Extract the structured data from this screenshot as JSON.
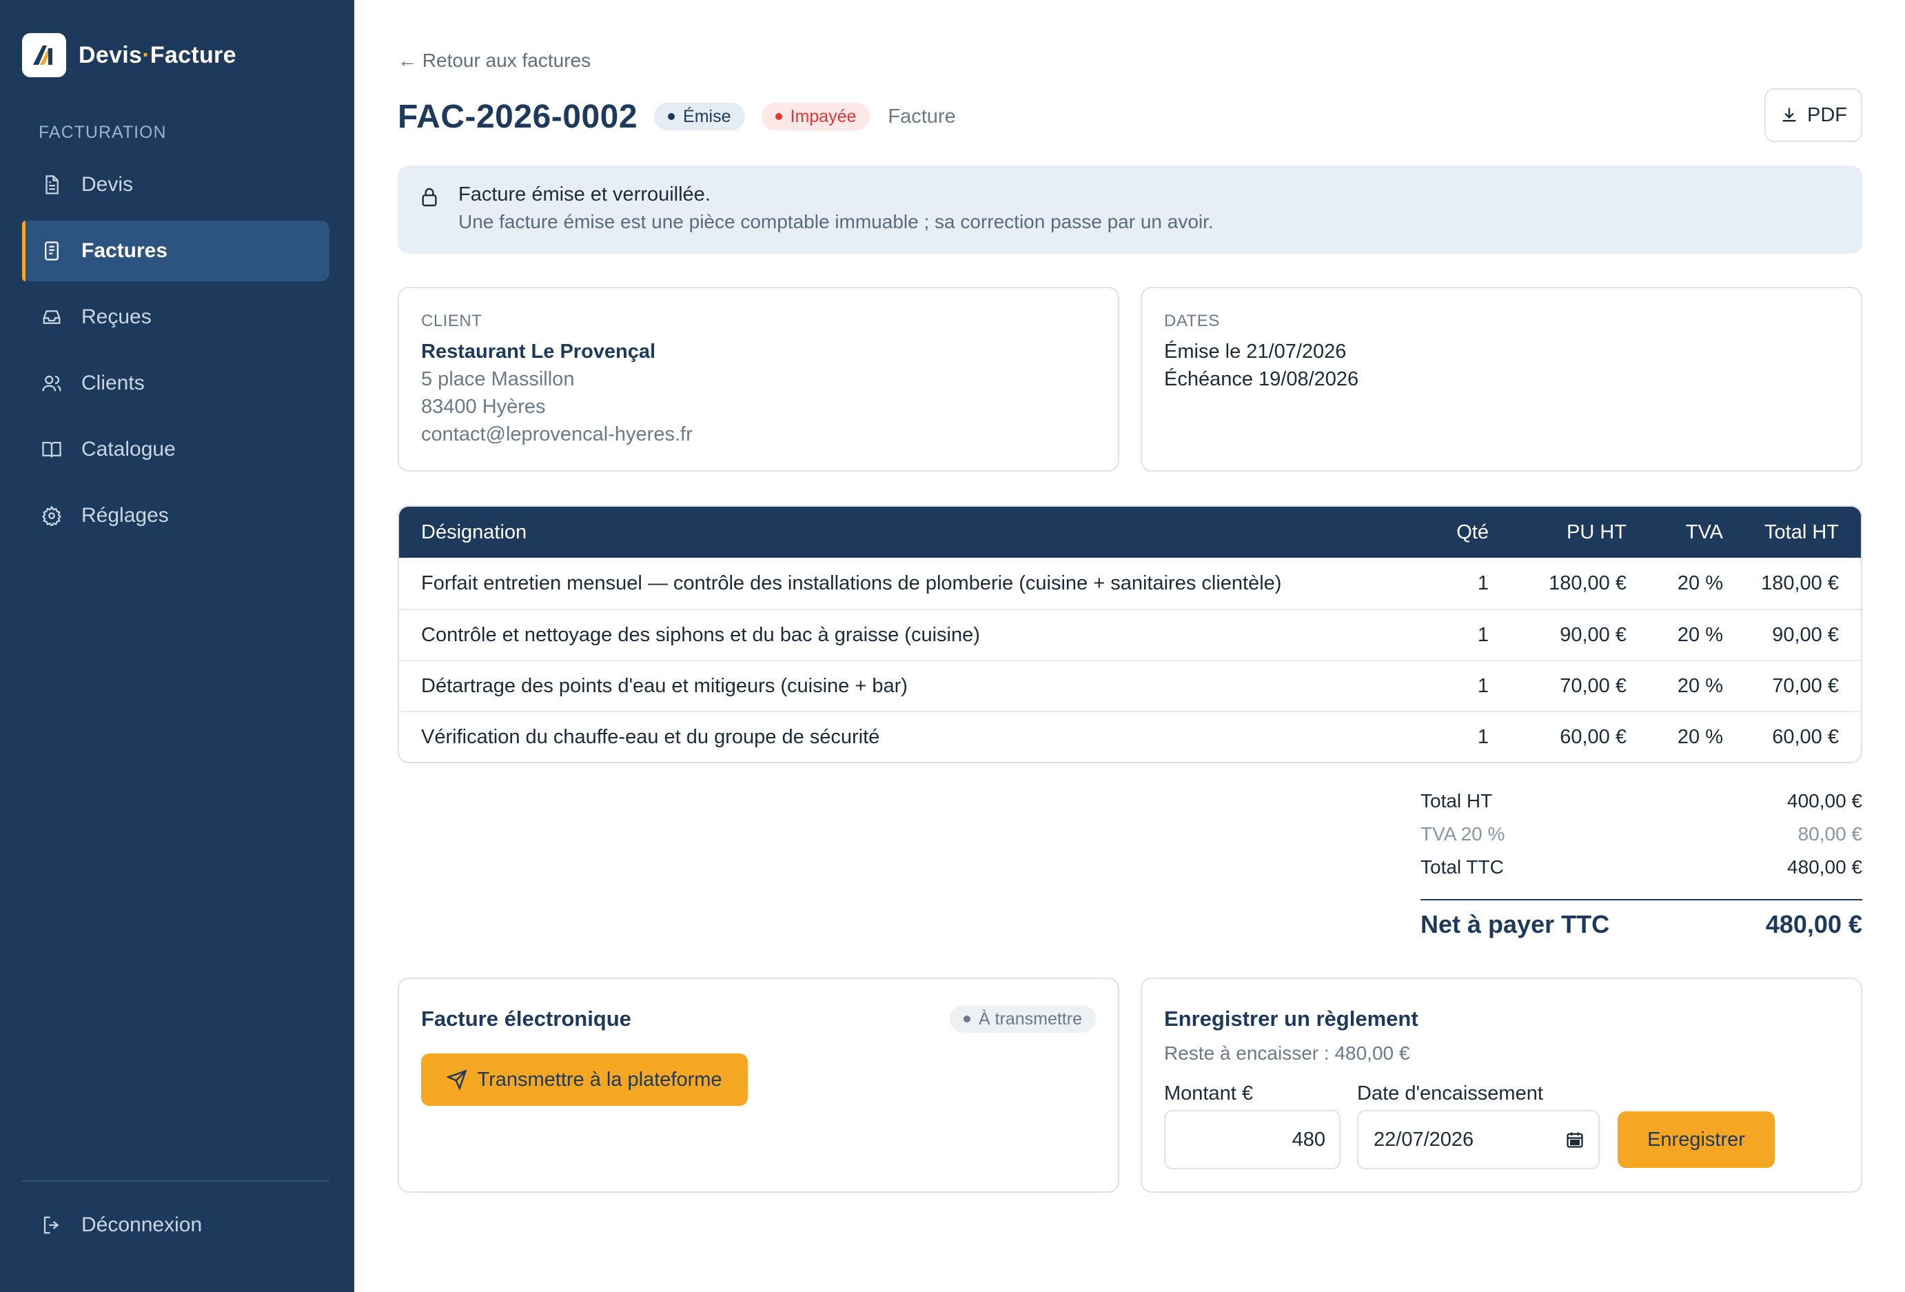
{
  "brand": {
    "name_part1": "Devis",
    "separator": "·",
    "name_part2": "Facture"
  },
  "sidebar": {
    "section_label": "FACTURATION",
    "items": [
      {
        "label": "Devis",
        "icon": "document-icon"
      },
      {
        "label": "Factures",
        "icon": "invoice-icon",
        "active": true
      },
      {
        "label": "Reçues",
        "icon": "inbox-icon"
      },
      {
        "label": "Clients",
        "icon": "users-icon"
      },
      {
        "label": "Catalogue",
        "icon": "book-icon"
      },
      {
        "label": "Réglages",
        "icon": "gear-icon"
      }
    ],
    "logout_label": "Déconnexion"
  },
  "header": {
    "back_link": "← Retour aux factures",
    "title": "FAC-2026-0002",
    "status_badge": "Émise",
    "payment_badge": "Impayée",
    "doc_type": "Facture",
    "pdf_label": "PDF"
  },
  "notice": {
    "title": "Facture émise et verrouillée.",
    "text": "Une facture émise est une pièce comptable immuable ; sa correction passe par un avoir."
  },
  "client": {
    "label": "CLIENT",
    "name": "Restaurant Le Provençal",
    "address": "5 place Massillon",
    "city": "83400 Hyères",
    "email": "contact@leprovencal-hyeres.fr"
  },
  "dates": {
    "label": "DATES",
    "issued": "Émise le 21/07/2026",
    "due": "Échéance 19/08/2026"
  },
  "table": {
    "headers": {
      "designation": "Désignation",
      "qty": "Qté",
      "unit_price": "PU HT",
      "vat": "TVA",
      "total": "Total HT"
    },
    "rows": [
      {
        "designation": "Forfait entretien mensuel — contrôle des installations de plomberie (cuisine + sanitaires clientèle)",
        "qty": "1",
        "unit_price": "180,00 €",
        "vat": "20 %",
        "total": "180,00 €"
      },
      {
        "designation": "Contrôle et nettoyage des siphons et du bac à graisse (cuisine)",
        "qty": "1",
        "unit_price": "90,00 €",
        "vat": "20 %",
        "total": "90,00 €"
      },
      {
        "designation": "Détartrage des points d'eau et mitigeurs (cuisine + bar)",
        "qty": "1",
        "unit_price": "70,00 €",
        "vat": "20 %",
        "total": "70,00 €"
      },
      {
        "designation": "Vérification du chauffe-eau et du groupe de sécurité",
        "qty": "1",
        "unit_price": "60,00 €",
        "vat": "20 %",
        "total": "60,00 €"
      }
    ]
  },
  "totals": {
    "ht_label": "Total HT",
    "ht_value": "400,00 €",
    "vat_label": "TVA 20 %",
    "vat_value": "80,00 €",
    "ttc_label": "Total TTC",
    "ttc_value": "480,00 €",
    "net_label": "Net à payer TTC",
    "net_value": "480,00 €"
  },
  "einvoice": {
    "title": "Facture électronique",
    "status": "À transmettre",
    "button_label": "Transmettre à la plateforme"
  },
  "payment": {
    "title": "Enregistrer un règlement",
    "remaining": "Reste à encaisser : 480,00 €",
    "amount_label": "Montant €",
    "amount_value": "480",
    "date_label": "Date d'encaissement",
    "date_value": "22/07/2026",
    "submit_label": "Enregistrer"
  },
  "colors": {
    "sidebar_bg": "#1d3a5c",
    "accent": "#f5a623",
    "danger": "#e03838"
  }
}
